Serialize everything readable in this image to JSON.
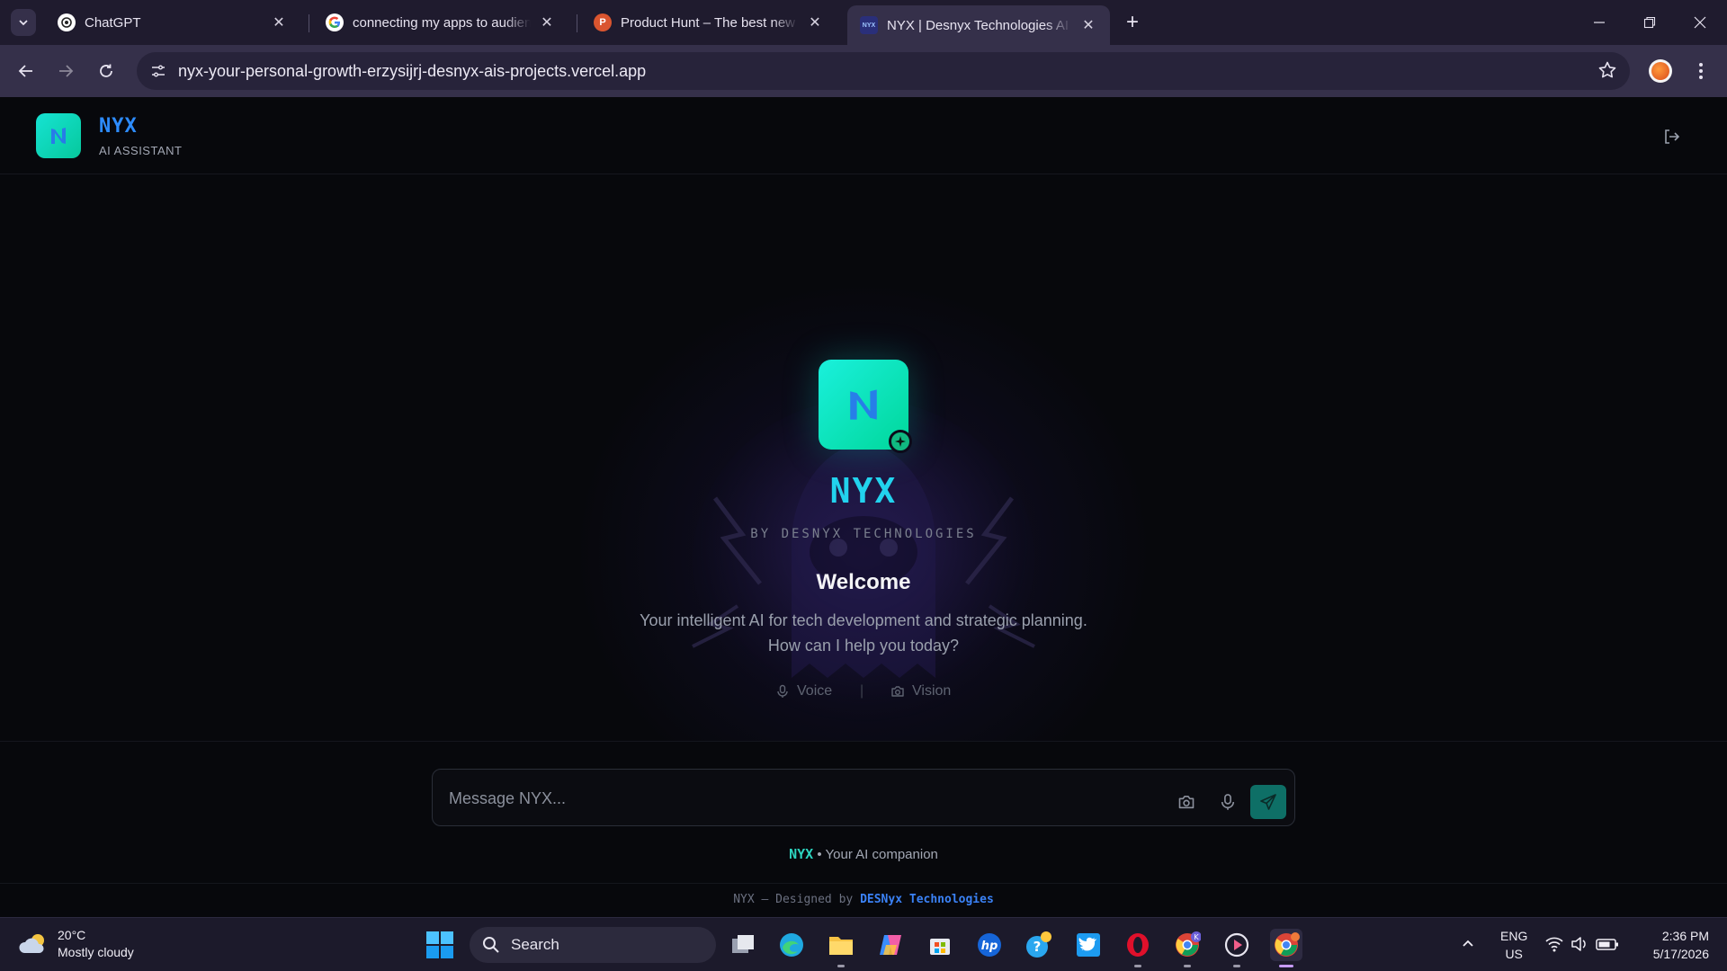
{
  "browser": {
    "tabs": [
      {
        "title": "ChatGPT",
        "icon": "chatgpt-icon"
      },
      {
        "title": "connecting my apps to audience",
        "icon": "google-icon"
      },
      {
        "title": "Product Hunt – The best new products",
        "icon": "producthunt-icon"
      },
      {
        "title": "NYX | Desnyx Technologies AI",
        "icon": "nyx-icon",
        "active": true
      }
    ],
    "url": "nyx-your-personal-growth-erzysijrj-desnyx-ais-projects.vercel.app",
    "favicon_nyx_label": "NYX",
    "favicon_ph_label": "P"
  },
  "app": {
    "brand": {
      "name": "NYX",
      "subtitle": "AI ASSISTANT"
    },
    "hero": {
      "title": "NYX",
      "byline": "BY DESNYX TECHNOLOGIES",
      "welcome": "Welcome",
      "description": "Your intelligent AI for tech development and strategic planning. How can I help you today?",
      "features": [
        {
          "label": "Voice",
          "icon": "microphone-icon"
        },
        {
          "label": "Vision",
          "icon": "camera-icon"
        }
      ],
      "separator": "|"
    },
    "composer": {
      "placeholder": "Message NYX...",
      "caption_name": "NYX",
      "caption_rest": " • Your AI companion"
    },
    "footer": {
      "prefix": "NYX — Designed by ",
      "company": "DESNyx Technologies"
    },
    "colors": {
      "accent": "#22d3ee",
      "brand_blue": "#2d8cff",
      "logo_gradient_start": "#1af0dc",
      "logo_gradient_end": "#00d79a",
      "send_button": "#0e6f66"
    }
  },
  "taskbar": {
    "weather": {
      "temp": "20°C",
      "condition": "Mostly cloudy"
    },
    "search_label": "Search",
    "language": {
      "lang": "ENG",
      "region": "US"
    },
    "clock": {
      "time": "2:36 PM",
      "date": "5/17/2026"
    },
    "chrome_badge": "K"
  }
}
